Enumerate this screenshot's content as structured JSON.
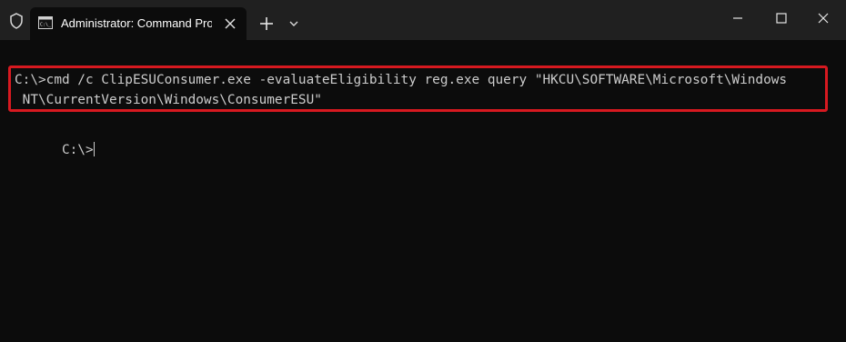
{
  "window": {
    "tab_title": "Administrator: Command Prompt",
    "icons": {
      "shield": "shield-icon",
      "cmd": "cmd-icon",
      "close_tab": "close-icon",
      "new_tab": "plus-icon",
      "dropdown": "chevron-down-icon",
      "minimize": "minimize-icon",
      "maximize": "maximize-icon",
      "close_window": "close-icon"
    }
  },
  "terminal": {
    "lines": [
      "C:\\>cmd /c ClipESUConsumer.exe -evaluateEligibility reg.exe query \"HKCU\\SOFTWARE\\Microsoft\\Windows",
      " NT\\CurrentVersion\\Windows\\ConsumerESU\"",
      "C:\\>"
    ]
  },
  "colors": {
    "highlight": "#d71920",
    "terminal_background": "#0c0c0c",
    "terminal_text": "#cccccc",
    "titlebar_background": "#202020"
  }
}
